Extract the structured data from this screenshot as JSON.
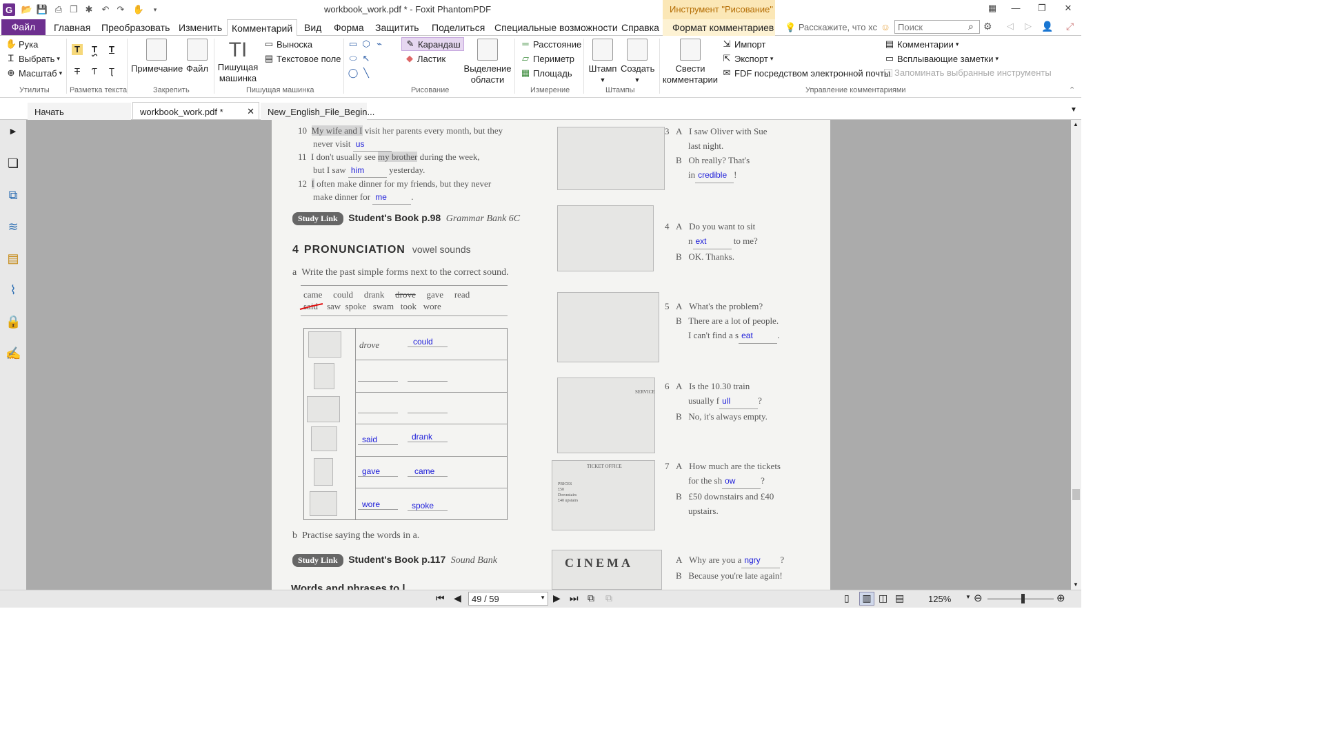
{
  "window": {
    "title": "workbook_work.pdf * - Foxit PhantomPDF",
    "context_tool": "Инструмент \"Рисование\""
  },
  "menu": {
    "file": "Файл",
    "tabs": [
      "Главная",
      "Преобразовать",
      "Изменить",
      "Комментарий",
      "Вид",
      "Форма",
      "Защитить",
      "Поделиться",
      "Специальные возможности",
      "Справка"
    ],
    "context_tab": "Формат комментариев",
    "ask": "Расскажите, что хс",
    "search_placeholder": "Поиск"
  },
  "ribbon": {
    "utilities": {
      "hand": "Рука",
      "select": "Выбрать",
      "zoom": "Масштаб",
      "label": "Утилиты"
    },
    "text_markup": {
      "label": "Разметка текста"
    },
    "pin": {
      "note": "Примечание",
      "file": "Файл",
      "label": "Закрепить"
    },
    "typewriter": {
      "typewriter": "Пишущая машинка",
      "callout": "Выноска",
      "textbox": "Текстовое поле",
      "label": "Пишущая машинка"
    },
    "drawing": {
      "pencil": "Карандаш",
      "eraser": "Ластик",
      "area": "Выделение области",
      "label": "Рисование"
    },
    "measure": {
      "distance": "Расстояние",
      "perimeter": "Периметр",
      "area": "Площадь",
      "label": "Измерение"
    },
    "stamps": {
      "stamp": "Штамп",
      "create": "Создать",
      "label": "Штампы"
    },
    "manage": {
      "summarize": "Свести комментарии",
      "import": "Импорт",
      "export": "Экспорт",
      "fdf": "FDF посредством электронной почты",
      "comments": "Комментарии",
      "popup": "Всплывающие заметки",
      "remember": "Запоминать выбранные инструменты",
      "label": "Управление комментариями"
    }
  },
  "doc_tabs": [
    "Начать",
    "workbook_work.pdf *",
    "New_English_File_Begin..."
  ],
  "page": {
    "items": [
      {
        "num": "10",
        "l1a": "My wife and I",
        "l1b": " visit her parents every month, but they",
        "l2": "never visit ",
        "ans": "us",
        "l2end": ""
      },
      {
        "num": "11",
        "l1a": "I don't usually see ",
        "hl": "my brother",
        "l1b": " during the week,",
        "l2": "but I saw ",
        "ans": "him",
        "l2end": " yesterday."
      },
      {
        "num": "12",
        "l1a": "I",
        "l1b": " often make dinner for my friends, but they never",
        "l2": "make dinner for ",
        "ans": "me",
        "l2end": "."
      }
    ],
    "study1": {
      "badge": "Study Link",
      "book": "Student's Book p.98",
      "ref": "Grammar Bank 6C"
    },
    "section": {
      "num": "4",
      "title": "PRONUNCIATION",
      "sub": "vowel sounds"
    },
    "task_a": {
      "letter": "a",
      "text": "Write the past simple forms next to the correct sound."
    },
    "words_row1": [
      "came",
      "could",
      "drank",
      "drove",
      "gave",
      "read"
    ],
    "words_row2": [
      "said",
      "saw",
      "spoke",
      "swam",
      "took",
      "wore"
    ],
    "table": [
      {
        "example": "drove",
        "ans1": "",
        "ans2": "could"
      },
      {
        "example": "",
        "ans1": "",
        "ans2": ""
      },
      {
        "example": "",
        "ans1": "",
        "ans2": ""
      },
      {
        "example": "",
        "ans1": "said",
        "ans2": "drank"
      },
      {
        "example": "",
        "ans1": "gave",
        "ans2": "came"
      },
      {
        "example": "",
        "ans1": "wore",
        "ans2": "spoke"
      }
    ],
    "task_b": {
      "letter": "b",
      "text": "Practise saying the words in a."
    },
    "study2": {
      "badge": "Study Link",
      "book": "Student's Book p.117",
      "ref": "Sound Bank"
    },
    "cut_heading": "Words and phrases to l",
    "dialogues": [
      {
        "num": "3",
        "a": "I saw Oliver with Sue",
        "a2": "last night.",
        "b": "Oh really? That's",
        "b2pre": "in",
        "b2ans": "credible",
        "b2post": "!"
      },
      {
        "num": "4",
        "a": "Do you want to sit",
        "a2pre": "n",
        "a2ans": "ext",
        "a2post": "to me?",
        "b": "OK. Thanks."
      },
      {
        "num": "5",
        "a": "What's the problem?",
        "b": "There are a lot of people.",
        "b2pre": "I can't find a s",
        "b2ans": "eat",
        "b2post": "."
      },
      {
        "num": "6",
        "a": "Is the 10.30 train",
        "a2pre": "usually f",
        "a2ans": "ull",
        "a2post": "?",
        "b": "No, it's always empty."
      },
      {
        "num": "7",
        "a": "How much are the tickets",
        "a2pre": "for the sh",
        "a2ans": "ow",
        "a2post": "?",
        "b": "£50 downstairs and £40",
        "b2": "upstairs."
      },
      {
        "num": "",
        "apre": "Why are you a",
        "aans": "ngry",
        "apost": "?",
        "b": "Because you're late again!"
      }
    ],
    "pic_labels": [
      "TICKET OFFICE",
      "PRICES £50 Downstairs £40 upstairs",
      "CINEMA",
      "SERVICE"
    ]
  },
  "status": {
    "page": "49 / 59",
    "zoom": "125%"
  }
}
